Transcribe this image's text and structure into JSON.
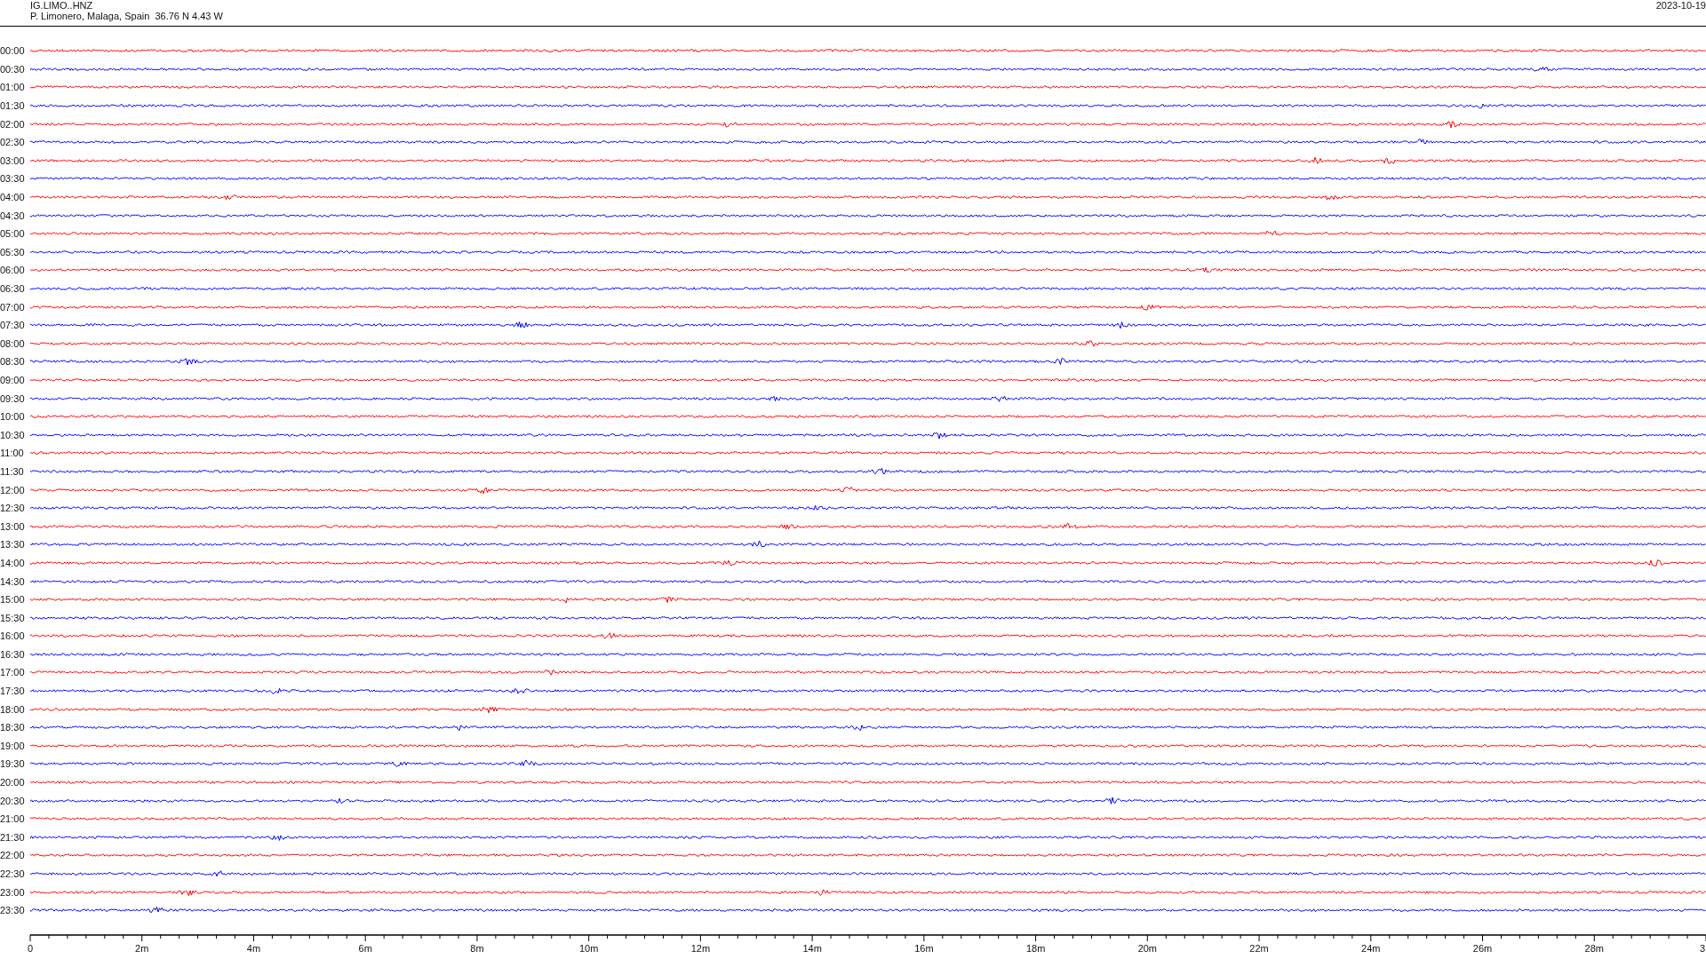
{
  "header": {
    "station": "IG.LIMO..HNZ",
    "location": "P. Limonero, Malaga, Spain  36.76 N 4.43 W",
    "date": "2023-10-19"
  },
  "traces": [
    {
      "time": "00:00",
      "color": "#ff0000"
    },
    {
      "time": "00:30",
      "color": "#0000ff"
    },
    {
      "time": "01:00",
      "color": "#ff0000"
    },
    {
      "time": "01:30",
      "color": "#0000ff"
    },
    {
      "time": "02:00",
      "color": "#ff0000"
    },
    {
      "time": "02:30",
      "color": "#0000ff"
    },
    {
      "time": "03:00",
      "color": "#ff0000"
    },
    {
      "time": "03:30",
      "color": "#0000ff"
    },
    {
      "time": "04:00",
      "color": "#ff0000"
    },
    {
      "time": "04:30",
      "color": "#0000ff"
    },
    {
      "time": "05:00",
      "color": "#ff0000"
    },
    {
      "time": "05:30",
      "color": "#0000ff"
    },
    {
      "time": "06:00",
      "color": "#ff0000"
    },
    {
      "time": "06:30",
      "color": "#0000ff"
    },
    {
      "time": "07:00",
      "color": "#ff0000"
    },
    {
      "time": "07:30",
      "color": "#0000ff"
    },
    {
      "time": "08:00",
      "color": "#ff0000"
    },
    {
      "time": "08:30",
      "color": "#0000ff"
    },
    {
      "time": "09:00",
      "color": "#ff0000"
    },
    {
      "time": "09:30",
      "color": "#0000ff"
    },
    {
      "time": "10:00",
      "color": "#ff0000"
    },
    {
      "time": "10:30",
      "color": "#0000ff"
    },
    {
      "time": "11:00",
      "color": "#ff0000"
    },
    {
      "time": "11:30",
      "color": "#0000ff"
    },
    {
      "time": "12:00",
      "color": "#ff0000"
    },
    {
      "time": "12:30",
      "color": "#0000ff"
    },
    {
      "time": "13:00",
      "color": "#ff0000"
    },
    {
      "time": "13:30",
      "color": "#0000ff"
    },
    {
      "time": "14:00",
      "color": "#ff0000"
    },
    {
      "time": "14:30",
      "color": "#0000ff"
    },
    {
      "time": "15:00",
      "color": "#ff0000"
    },
    {
      "time": "15:30",
      "color": "#0000ff"
    },
    {
      "time": "16:00",
      "color": "#ff0000"
    },
    {
      "time": "16:30",
      "color": "#0000ff"
    },
    {
      "time": "17:00",
      "color": "#ff0000"
    },
    {
      "time": "17:30",
      "color": "#0000ff"
    },
    {
      "time": "18:00",
      "color": "#ff0000"
    },
    {
      "time": "18:30",
      "color": "#0000ff"
    },
    {
      "time": "19:00",
      "color": "#ff0000"
    },
    {
      "time": "19:30",
      "color": "#0000ff"
    },
    {
      "time": "20:00",
      "color": "#ff0000"
    },
    {
      "time": "20:30",
      "color": "#0000ff"
    },
    {
      "time": "21:00",
      "color": "#ff0000"
    },
    {
      "time": "21:30",
      "color": "#0000ff"
    },
    {
      "time": "22:00",
      "color": "#ff0000"
    },
    {
      "time": "22:30",
      "color": "#0000ff"
    },
    {
      "time": "23:00",
      "color": "#ff0000"
    },
    {
      "time": "23:30",
      "color": "#0000ff"
    }
  ],
  "axis": {
    "ticks": [
      "0",
      "2m",
      "4m",
      "6m",
      "8m",
      "10m",
      "12m",
      "14m",
      "16m",
      "18m",
      "20m",
      "22m",
      "24m",
      "26m",
      "28m",
      "3"
    ]
  }
}
